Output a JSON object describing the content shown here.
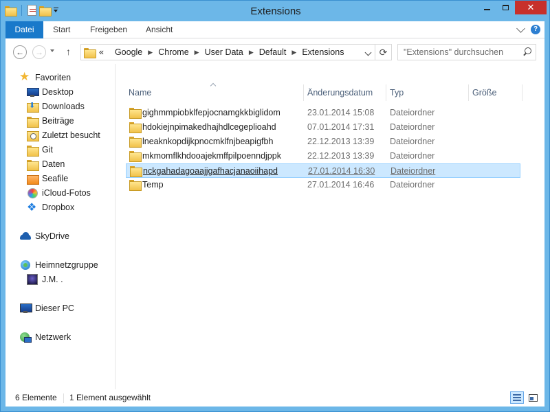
{
  "window": {
    "title": "Extensions",
    "close_glyph": "✕"
  },
  "ribbon": {
    "tabs": [
      {
        "label": "Datei"
      },
      {
        "label": "Start"
      },
      {
        "label": "Freigeben"
      },
      {
        "label": "Ansicht"
      }
    ],
    "help_glyph": "?"
  },
  "navigation": {
    "back_glyph": "←",
    "forward_glyph": "→",
    "up_glyph": "↑",
    "breadcrumb_prefix": "«",
    "breadcrumb": [
      "Google",
      "Chrome",
      "User Data",
      "Default",
      "Extensions"
    ],
    "refresh_glyph": "⟳",
    "search_placeholder": "\"Extensions\" durchsuchen"
  },
  "nav_pane": {
    "favorites_label": "Favoriten",
    "favorites": [
      {
        "label": "Desktop",
        "icon": "desktop-icon"
      },
      {
        "label": "Downloads",
        "icon": "downloads-folder-icon"
      },
      {
        "label": "Beiträge",
        "icon": "folder-icon"
      },
      {
        "label": "Zuletzt besucht",
        "icon": "recent-places-icon"
      },
      {
        "label": "Git",
        "icon": "folder-icon"
      },
      {
        "label": "Daten",
        "icon": "folder-icon"
      },
      {
        "label": "Seafile",
        "icon": "seafile-folder-icon"
      },
      {
        "label": "iCloud-Fotos",
        "icon": "icloud-photos-icon"
      },
      {
        "label": "Dropbox",
        "icon": "dropbox-icon"
      }
    ],
    "skydrive_label": "SkyDrive",
    "homegroup_label": "Heimnetzgruppe",
    "homegroup_user": "J.M. .",
    "pc_label": "Dieser PC",
    "network_label": "Netzwerk"
  },
  "file_list": {
    "columns": {
      "name": "Name",
      "date": "Änderungsdatum",
      "type": "Typ",
      "size": "Größe"
    },
    "rows": [
      {
        "name": "gighmmpiobklfepjocnamgkkbiglidom",
        "date": "23.01.2014 15:08",
        "type": "Dateiordner",
        "selected": false
      },
      {
        "name": "hdokiejnpimakedhajhdlcegeplioahd",
        "date": "07.01.2014 17:31",
        "type": "Dateiordner",
        "selected": false
      },
      {
        "name": "lneaknkopdijkpnocmklfnjbeapigfbh",
        "date": "22.12.2013 13:39",
        "type": "Dateiordner",
        "selected": false
      },
      {
        "name": "mkmomflkhdooajekmffpilpoenndjppk",
        "date": "22.12.2013 13:39",
        "type": "Dateiordner",
        "selected": false
      },
      {
        "name": "nckgahadagoaajjgafhacjanaoiihapd",
        "date": "27.01.2014 16:30",
        "type": "Dateiordner",
        "selected": true
      },
      {
        "name": "Temp",
        "date": "27.01.2014 16:46",
        "type": "Dateiordner",
        "selected": false
      }
    ]
  },
  "status_bar": {
    "item_count": "6 Elemente",
    "selection": "1 Element ausgewählt"
  },
  "colors": {
    "title_bar": "#6cb7e8",
    "file_tab": "#1979ca",
    "selection": "#cce8ff",
    "close_button": "#c7302b"
  }
}
